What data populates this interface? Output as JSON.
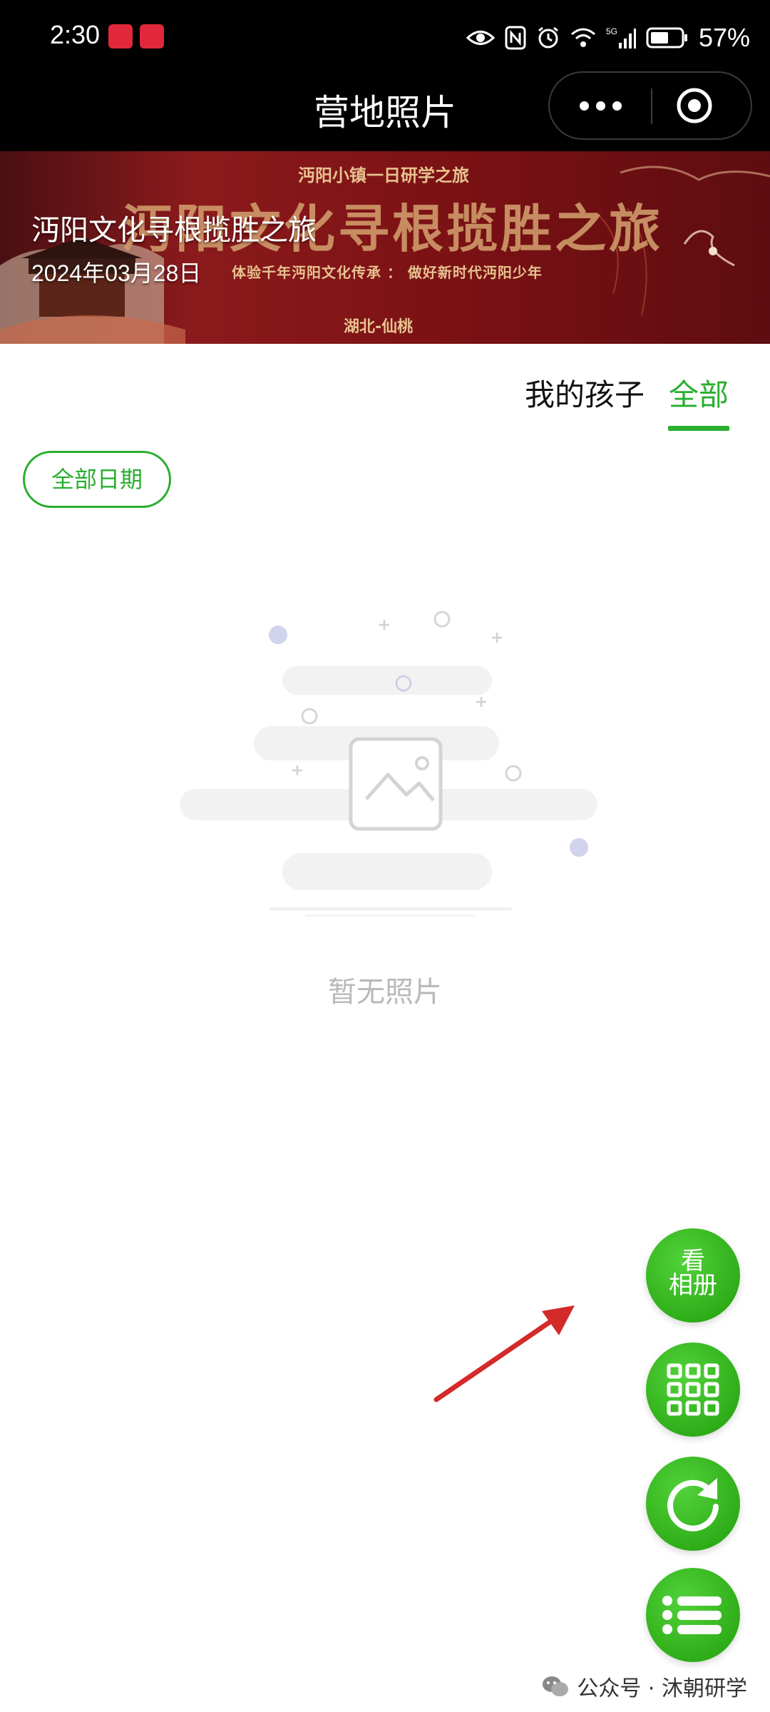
{
  "status_bar": {
    "time": "2:30",
    "battery": "57%",
    "icons": [
      "book-app-icon",
      "heart-app-icon",
      "eye-icon",
      "nfc-icon",
      "alarm-icon",
      "wifi-icon",
      "signal-5g-icon",
      "battery-icon"
    ]
  },
  "header": {
    "title": "营地照片",
    "more_icon": "more-dots-icon",
    "close_icon": "target-close-icon"
  },
  "banner": {
    "title": "沔阳文化寻根揽胜之旅",
    "date": "2024年03月28日",
    "art_top": "沔阳小镇一日研学之旅",
    "art_title": "沔阳文化寻根揽胜之旅",
    "art_subtitle": "体验千年沔阳文化传承  ：  做好新时代沔阳少年",
    "art_location": "湖北-仙桃",
    "colors": {
      "background": "#7a1114",
      "art_text": "#d09a6a"
    }
  },
  "tabs": [
    {
      "label": "我的孩子",
      "active": false
    },
    {
      "label": "全部",
      "active": true
    }
  ],
  "filter": {
    "date_label": "全部日期"
  },
  "empty_state": {
    "text": "暂无照片",
    "icon": "image-placeholder-icon"
  },
  "fabs": {
    "album_line1": "看",
    "album_line2": "相册",
    "grid_icon": "grid-icon",
    "refresh_icon": "refresh-icon",
    "list_icon": "list-menu-icon"
  },
  "watermark": {
    "text": "公众号 · 沐朝研学",
    "icon": "wechat-icon"
  },
  "colors": {
    "accent": "#2aae2e",
    "annotation_arrow": "#d42a2a",
    "header_bg": "#000000"
  }
}
